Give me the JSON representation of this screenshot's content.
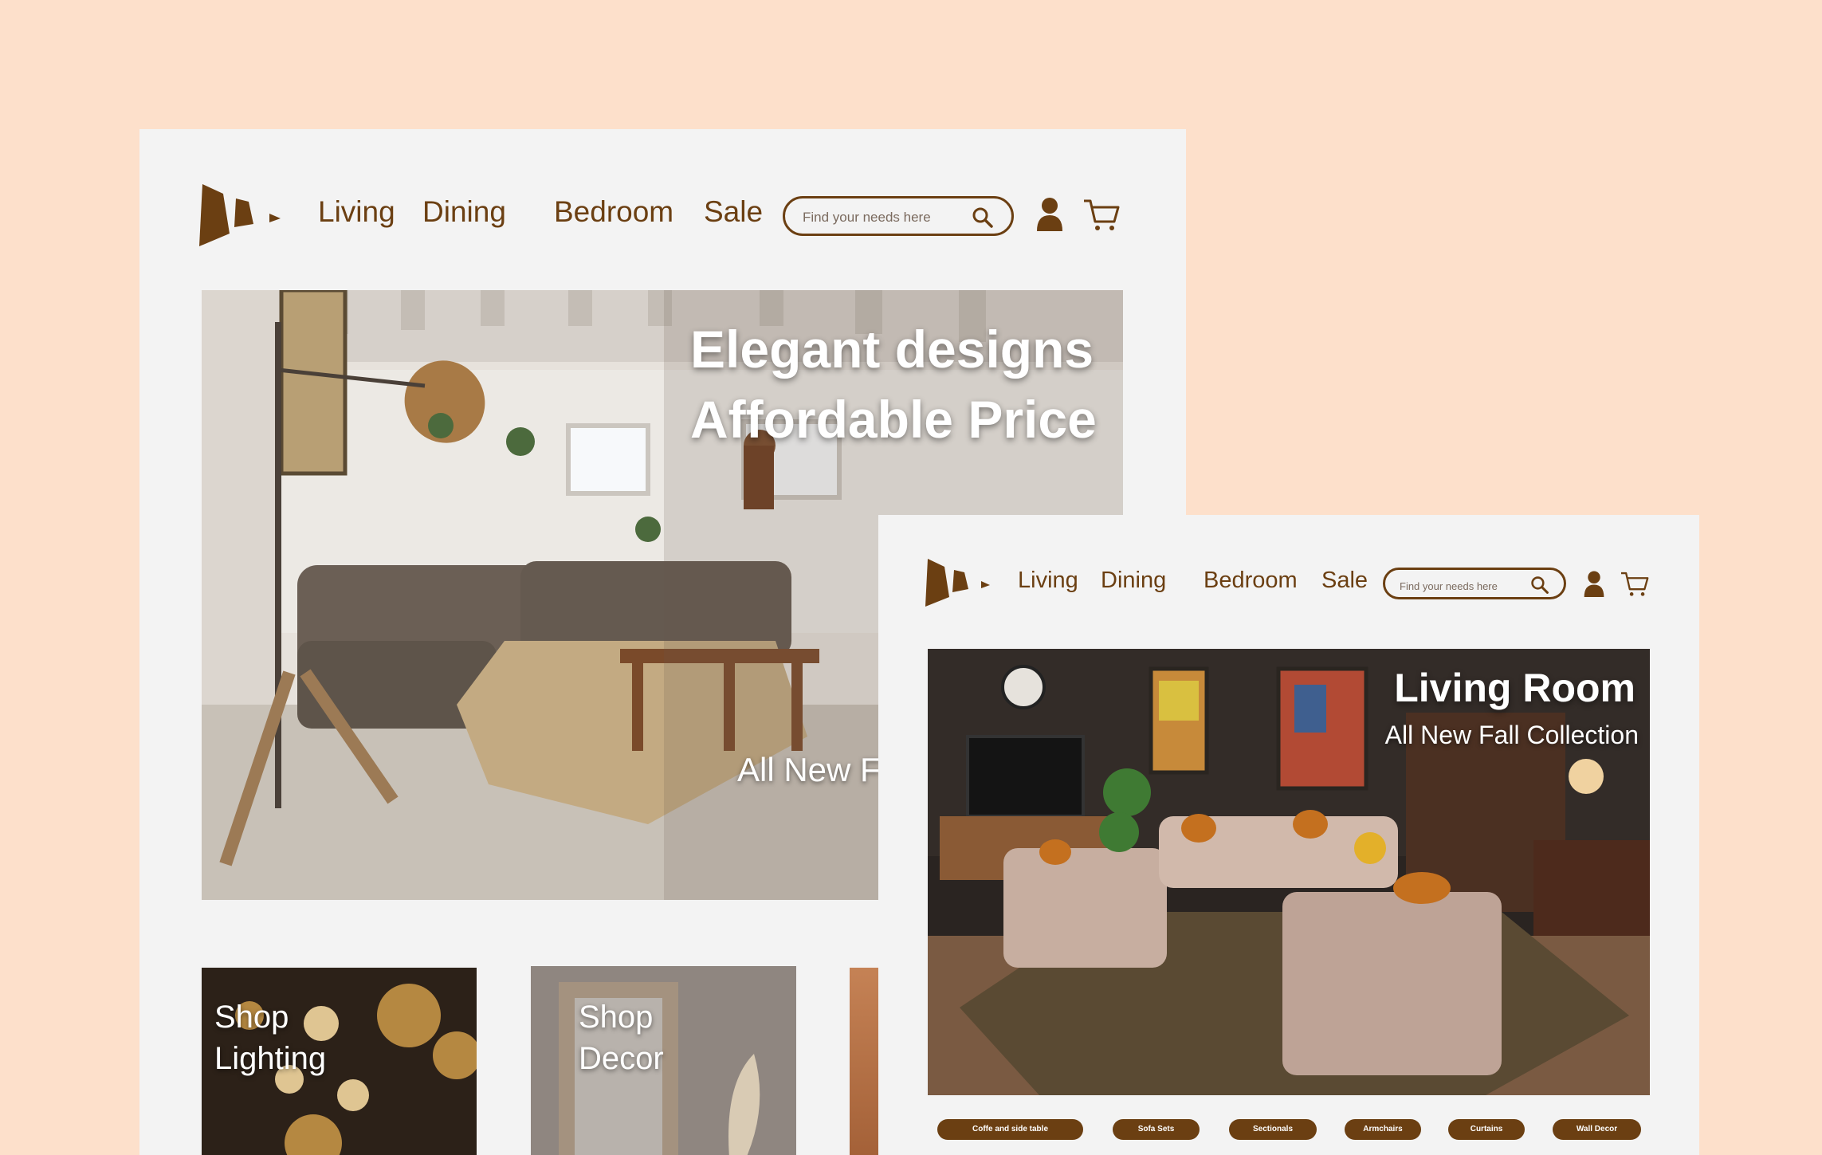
{
  "colors": {
    "page_background": "#fde0cb",
    "panel_background": "#f3f3f3",
    "brand_brown": "#6b3f12",
    "text_on_image": "#ffffff"
  },
  "desktop": {
    "logo_icon": "brand-logo-icon",
    "nav": [
      "Living",
      "Dining",
      "Bedroom",
      "Sale"
    ],
    "search": {
      "placeholder": "Find your needs here",
      "icon": "search-icon"
    },
    "account_icon": "user-icon",
    "cart_icon": "cart-icon",
    "hero": {
      "title_line1": "Elegant designs",
      "title_line2": "Affordable Price",
      "subtitle": "All New F"
    },
    "tiles": [
      {
        "line1": "Shop",
        "line2": "Lighting"
      },
      {
        "line1": "Shop",
        "line2": "Decor"
      }
    ]
  },
  "tablet": {
    "logo_icon": "brand-logo-icon",
    "nav": [
      "Living",
      "Dining",
      "Bedroom",
      "Sale"
    ],
    "search": {
      "placeholder": "Find your needs here",
      "icon": "search-icon"
    },
    "account_icon": "user-icon",
    "cart_icon": "cart-icon",
    "hero": {
      "title": "Living Room",
      "subtitle": "All New Fall Collection"
    },
    "categories": [
      "Coffe and side table",
      "Sofa Sets",
      "Sectionals",
      "Armchairs",
      "Curtains",
      "Wall Decor"
    ]
  }
}
